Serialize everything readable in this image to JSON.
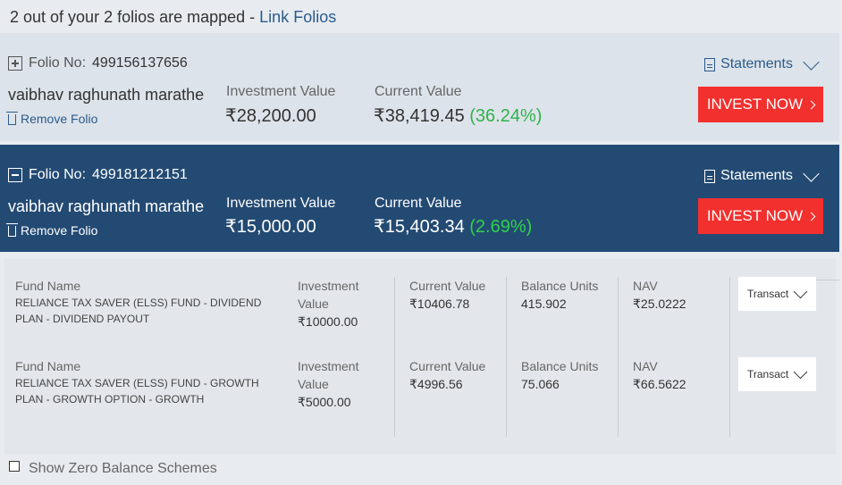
{
  "header": {
    "mapped_text": "2 out of your 2 folios are mapped - ",
    "link_label": "Link Folios"
  },
  "folios": [
    {
      "folio_label": "Folio No:",
      "folio_no": "499156137656",
      "owner": "vaibhav raghunath marathe",
      "remove_label": "Remove Folio",
      "investment_label": "Investment Value",
      "investment_value": "₹28,200.00",
      "current_label": "Current Value",
      "current_value": "₹38,419.45",
      "gain": "(36.24%)",
      "statements_label": "Statements",
      "invest_label": "INVEST NOW",
      "expanded": false
    },
    {
      "folio_label": "Folio No:",
      "folio_no": "499181212151",
      "owner": "vaibhav raghunath marathe",
      "remove_label": "Remove Folio",
      "investment_label": "Investment Value",
      "investment_value": "₹15,000.00",
      "current_label": "Current Value",
      "current_value": "₹15,403.34",
      "gain": "(2.69%)",
      "statements_label": "Statements",
      "invest_label": "INVEST NOW",
      "expanded": true
    }
  ],
  "schemes": [
    {
      "fund_label": "Fund Name",
      "fund_line1": "RELIANCE TAX SAVER (ELSS) FUND - DIVIDEND",
      "fund_line2": "PLAN - DIVIDEND PAYOUT",
      "inv_label1": "Investment",
      "inv_label2": "Value",
      "inv_value": "₹10000.00",
      "cur_label": "Current Value",
      "cur_value": "₹10406.78",
      "units_label": "Balance Units",
      "units_value": "415.902",
      "nav_label": "NAV",
      "nav_value": "₹25.0222",
      "transact_label": "Transact"
    },
    {
      "fund_label": "Fund Name",
      "fund_line1": "RELIANCE TAX SAVER (ELSS) FUND - GROWTH",
      "fund_line2": "PLAN - GROWTH OPTION - GROWTH",
      "inv_label1": "Investment",
      "inv_label2": "Value",
      "inv_value": "₹5000.00",
      "cur_label": "Current Value",
      "cur_value": "₹4996.56",
      "units_label": "Balance Units",
      "units_value": "75.066",
      "nav_label": "NAV",
      "nav_value": "₹66.5622",
      "transact_label": "Transact"
    }
  ],
  "footer": {
    "zero_balance_label": "Show Zero Balance Schemes",
    "zero_balance_checked": false
  },
  "colors": {
    "expanded_bg": "#234a73",
    "invest_button": "#f2302e",
    "gain_green": "#2fb24a",
    "link_blue": "#2a5b8c"
  }
}
